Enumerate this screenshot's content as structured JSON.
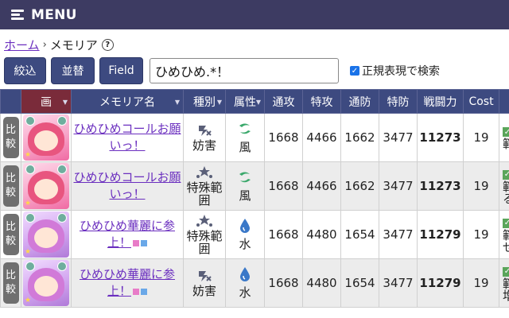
{
  "menu": {
    "label": "MENU"
  },
  "breadcrumb": {
    "home": "ホーム",
    "separator": "›",
    "current": "メモリア",
    "help": "?"
  },
  "toolbar": {
    "buttons": [
      "絞込",
      "並替",
      "Field"
    ],
    "search_value": "ひめひめ.*！",
    "regex_label": "正規表現で検索",
    "regex_checked": true
  },
  "table": {
    "headers": [
      "画",
      "メモリア名",
      "種別",
      "属性",
      "通攻",
      "特攻",
      "通防",
      "特防",
      "戦闘力",
      "Cost"
    ],
    "compare_label": [
      "比",
      "較"
    ],
    "rows": [
      {
        "name": "ひめひめコールお願いっ！",
        "type": "妨害",
        "attr": "風",
        "atk": "1668",
        "satk": "4466",
        "def": "1662",
        "sdef": "3477",
        "power": "11273",
        "cost": "19",
        "extra": [
          "範"
        ]
      },
      {
        "name": "ひめひめコールお願いっ！",
        "type": "特殊範囲",
        "attr": "風",
        "atk": "1668",
        "satk": "4466",
        "def": "1662",
        "sdef": "3477",
        "power": "11273",
        "cost": "19",
        "extra": [
          "範",
          "る"
        ]
      },
      {
        "name": "ひめひめ華麗に参上！",
        "type": "特殊範囲",
        "attr": "水",
        "atk": "1668",
        "satk": "4480",
        "def": "1654",
        "sdef": "3477",
        "power": "11279",
        "cost": "19",
        "extra": [
          "範",
          "せ"
        ]
      },
      {
        "name": "ひめひめ華麗に参上！",
        "type": "妨害",
        "attr": "水",
        "atk": "1668",
        "satk": "4480",
        "def": "1654",
        "sdef": "3477",
        "power": "11279",
        "cost": "19",
        "extra": [
          "範",
          "増"
        ]
      }
    ]
  },
  "colors": {
    "header_bg": "#3d4a80",
    "menubar_bg": "#3d3b62",
    "link": "#6b2fbf",
    "sorted_header": "#7a2b3a",
    "wind": "#3aa86b",
    "water": "#3a78c8"
  }
}
